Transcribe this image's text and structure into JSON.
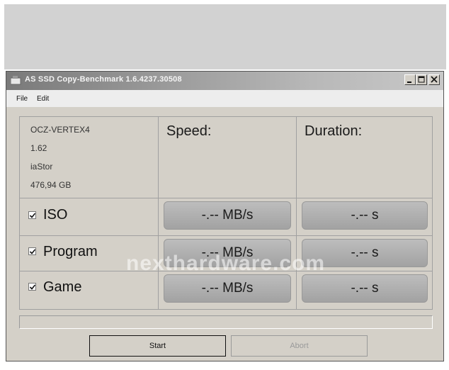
{
  "window": {
    "title": "AS SSD Copy-Benchmark 1.6.4237.30508",
    "controls": {
      "minimize": "_",
      "maximize": "□",
      "close": "×"
    }
  },
  "menu": {
    "file": "File",
    "edit": "Edit"
  },
  "drive": {
    "model": "OCZ-VERTEX4",
    "firmware": "1.62",
    "driver": "iaStor",
    "capacity": "476,94 GB"
  },
  "columns": {
    "speed": "Speed:",
    "duration": "Duration:"
  },
  "rows": [
    {
      "label": "ISO",
      "checked": true,
      "speed": "-.-- MB/s",
      "duration": "-.-- s"
    },
    {
      "label": "Program",
      "checked": true,
      "speed": "-.-- MB/s",
      "duration": "-.-- s"
    },
    {
      "label": "Game",
      "checked": true,
      "speed": "-.-- MB/s",
      "duration": "-.-- s"
    }
  ],
  "watermark": "nexthardware.com",
  "progress": {
    "value": 0
  },
  "buttons": {
    "start": "Start",
    "abort": "Abort"
  },
  "icons": {
    "app": "app-icon",
    "check": "checkmark-icon"
  },
  "colors": {
    "window_bg": "#d4d0c8",
    "result_bg": "#a8a8a8",
    "titlebar": "#8a8a8a"
  }
}
